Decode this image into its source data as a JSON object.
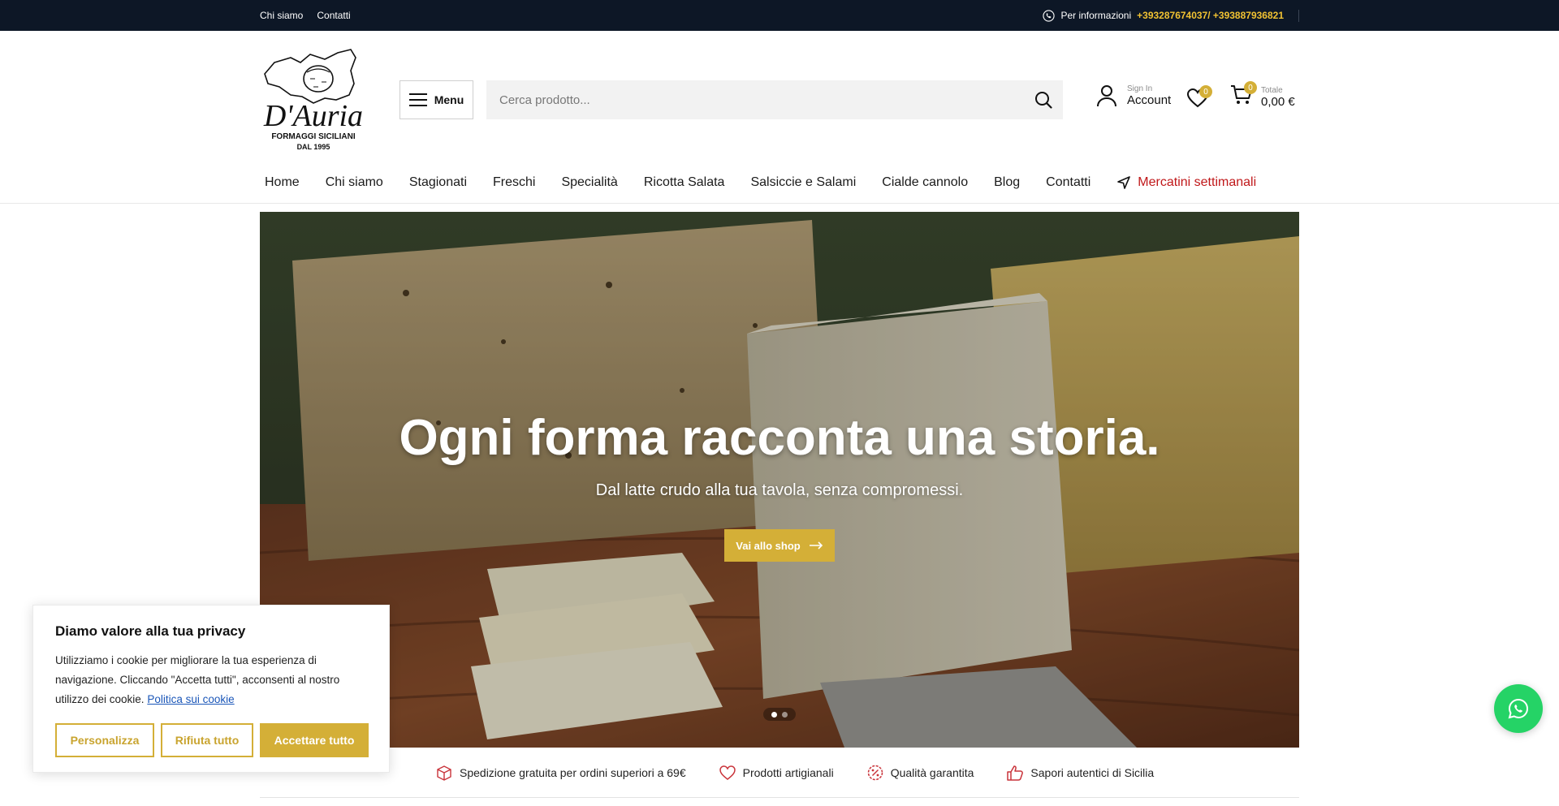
{
  "topbar": {
    "links": [
      "Chi siamo",
      "Contatti"
    ],
    "info_label": "Per informazioni",
    "phones": "+393287674037/ +393887936821"
  },
  "brand": {
    "name": "D'Auria",
    "tagline": "FORMAGGI SICILIANI",
    "since": "DAL 1995",
    "accent": "#d4af37"
  },
  "header": {
    "menu_label": "Menu",
    "search_placeholder": "Cerca prodotto...",
    "account_small": "Sign In",
    "account_big": "Account",
    "wishlist_count": "0",
    "cart_count": "0",
    "cart_small": "Totale",
    "cart_total": "0,00 €"
  },
  "nav": {
    "items": [
      "Home",
      "Chi siamo",
      "Stagionati",
      "Freschi",
      "Specialità",
      "Ricotta Salata",
      "Salsiccie e Salami",
      "Cialde cannolo",
      "Blog",
      "Contatti"
    ],
    "highlight": "Mercatini settimanali"
  },
  "hero": {
    "title": "Ogni forma racconta una storia.",
    "subtitle": "Dal latte crudo alla tua tavola, senza compromessi.",
    "button": "Vai allo shop",
    "slides_total": 2,
    "active_slide": 1
  },
  "features": [
    {
      "icon": "box-icon",
      "label": "Spedizione gratuita per ordini superiori a 69€"
    },
    {
      "icon": "heart-icon",
      "label": "Prodotti artigianali"
    },
    {
      "icon": "percent-badge-icon",
      "label": "Qualità garantita"
    },
    {
      "icon": "thumbs-up-icon",
      "label": "Sapori autentici di Sicilia"
    }
  ],
  "cookie": {
    "title": "Diamo valore alla tua privacy",
    "text": "Utilizziamo i cookie per migliorare la tua esperienza di navigazione. Cliccando \"Accetta tutti\", acconsenti al nostro utilizzo dei cookie.",
    "link": "Politica sui cookie",
    "customize": "Personalizza",
    "reject": "Rifiuta tutto",
    "accept": "Accettare tutto"
  },
  "whatsapp": {
    "icon": "whatsapp-icon"
  }
}
